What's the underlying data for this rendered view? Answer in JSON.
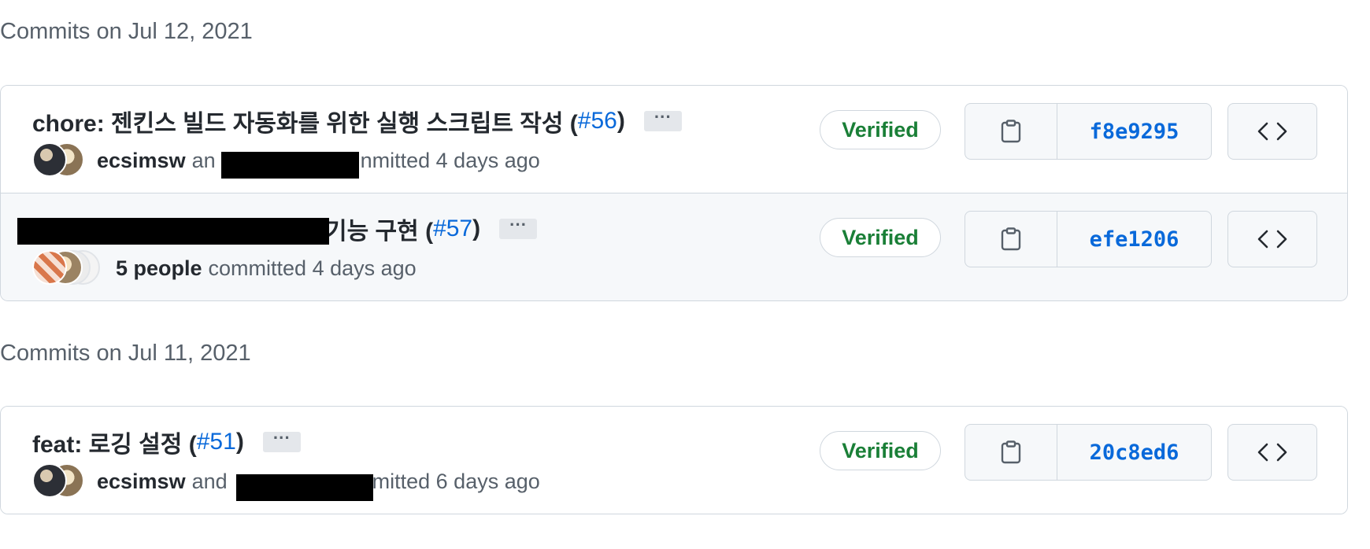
{
  "days": [
    {
      "header": "Commits on Jul 12, 2021",
      "commits": [
        {
          "title_prefix": "chore: 젠킨스 빌드 자동화를 위한 실행 스크립트 작성 (",
          "pr": "#56",
          "title_suffix": ")",
          "ellipsis": "···",
          "author": "ecsimsw",
          "meta_text": "an",
          "meta_tail": "nmitted 4 days ago",
          "verified": "Verified",
          "sha": "f8e9295",
          "browse_icon": "code-icon",
          "copy_icon": "clipboard-icon"
        },
        {
          "title_prefix": "기능 구현 (",
          "pr": "#57",
          "title_suffix": ")",
          "ellipsis": "···",
          "author": "5 people",
          "meta_text": "committed 4 days ago",
          "meta_tail": "",
          "verified": "Verified",
          "sha": "efe1206",
          "browse_icon": "code-icon",
          "copy_icon": "clipboard-icon"
        }
      ]
    },
    {
      "header": "Commits on Jul 11, 2021",
      "commits": [
        {
          "title_prefix": "feat: 로깅 설정 (",
          "pr": "#51",
          "title_suffix": ")",
          "ellipsis": "···",
          "author": "ecsimsw",
          "meta_text": "and",
          "meta_tail": "mitted 6 days ago",
          "verified": "Verified",
          "sha": "20c8ed6",
          "browse_icon": "code-icon",
          "copy_icon": "clipboard-icon"
        }
      ]
    }
  ],
  "colors": {
    "link": "#0969da",
    "verified": "#1a7f37",
    "border": "#d0d7de",
    "muted": "#57606a"
  }
}
